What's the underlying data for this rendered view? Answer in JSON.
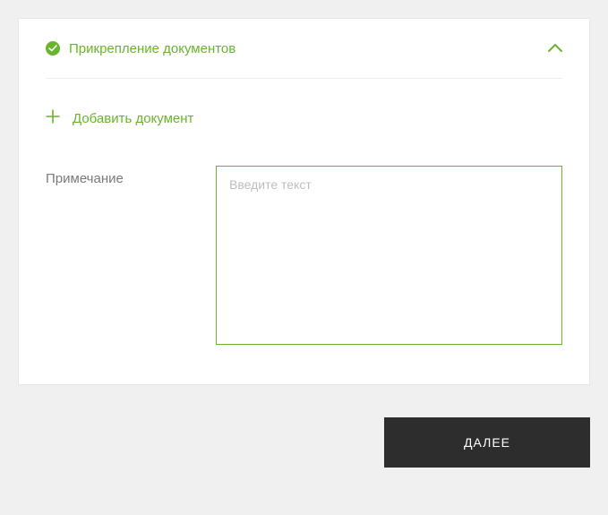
{
  "panel": {
    "title": "Прикрепление документов",
    "status_icon": "check-circle-icon",
    "collapse_icon": "chevron-up-icon"
  },
  "add_document": {
    "icon": "plus-icon",
    "label": "Добавить документ"
  },
  "note": {
    "label": "Примечание",
    "placeholder": "Введите текст",
    "value": ""
  },
  "footer": {
    "next_label": "ДАЛЕЕ"
  },
  "colors": {
    "accent": "#6ab42d",
    "button_bg": "#2d2d2d",
    "bg": "#f0f0f0",
    "panel_bg": "#ffffff",
    "text_muted": "#7a7a7a",
    "placeholder": "#bdbdbd"
  }
}
